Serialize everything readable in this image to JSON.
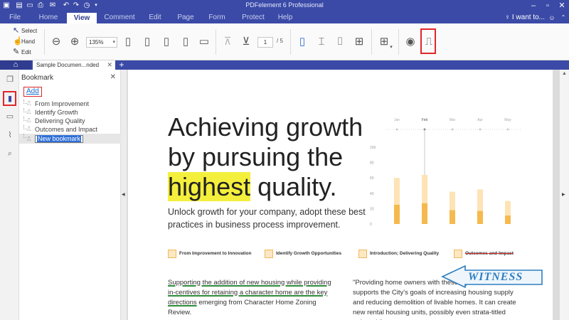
{
  "app": {
    "title": "PDFelement 6 Professional"
  },
  "menu": {
    "items": [
      "File",
      "Home",
      "View",
      "Comment",
      "Edit",
      "Page",
      "Form",
      "Protect",
      "Help"
    ],
    "active": "View",
    "search_label": "I want to..."
  },
  "ribbon": {
    "modes": [
      "Select",
      "Hand",
      "Edit"
    ],
    "zoom_value": "135%",
    "page_current": "1",
    "page_total": "/ 5"
  },
  "tabs": {
    "document_tab": "Sample Documen...nded"
  },
  "bookmark_panel": {
    "title": "Bookmark",
    "add_label": "Add",
    "items": [
      "From Improvement",
      "Identify Growth",
      "Delivering Quality",
      "Outcomes and Impact"
    ],
    "editing_value": "New bookmark"
  },
  "document": {
    "headline_line1": "Achieving growth",
    "headline_line2": "by pursuing the",
    "headline_highlight": "highest",
    "headline_rest": " quality.",
    "subtext": "Unlock growth for your company, adopt these best practices in business process improvement.",
    "legend": [
      "From Improvement to Innovation",
      "Identify Growth Opportunities",
      "Introduction; Delivering Quality",
      "Outcomes and Impact"
    ],
    "para_left_underlined": "Supporting the addition of new housing while providing in-centives for retaining a character home are the key directions",
    "para_left_rest": "emerging from Character Home Zoning Review.",
    "para_right": "\"Providing home owners with these types of incentives supports the City's goals of increasing housing supply and reducing demolition of livable homes.  It can create new rental housing units, possibly even strata-titled units, while",
    "stamp_text": "WITNESS",
    "colors": {
      "highlight": "#f4ef3c",
      "bar_light": "#fde3b5",
      "bar_dark": "#f5b94e",
      "stamp": "#2f7ec1"
    }
  },
  "chart_data": {
    "type": "bar",
    "categories": [
      "Jan",
      "Feb",
      "Mar",
      "Apr",
      "May"
    ],
    "y_ticks": [
      "100",
      "80",
      "60",
      "40",
      "20",
      "0"
    ],
    "ylim": [
      0,
      100
    ],
    "series": [
      {
        "values": [
          60,
          64,
          42,
          45,
          30
        ]
      },
      {
        "values": [
          25,
          27,
          18,
          17,
          11
        ]
      }
    ]
  }
}
